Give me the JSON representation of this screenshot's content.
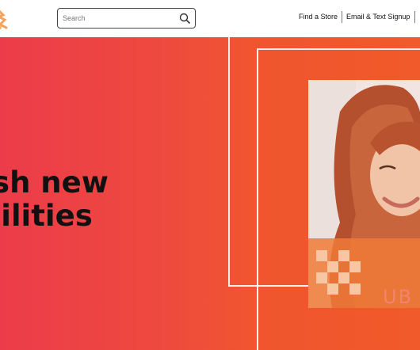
{
  "header": {
    "search": {
      "placeholder": "Search",
      "value": ""
    },
    "nav": [
      "Find a Store",
      "Email & Text Signup"
    ]
  },
  "hero": {
    "headline_line1": "eash new",
    "headline_line2": "sibilities",
    "photo_caption": "UB"
  },
  "colors": {
    "hero_left": "#ec3c4a",
    "hero_right": "#f15a2a",
    "frame": "#ffffff",
    "logo_orange": "#f5a25c"
  }
}
